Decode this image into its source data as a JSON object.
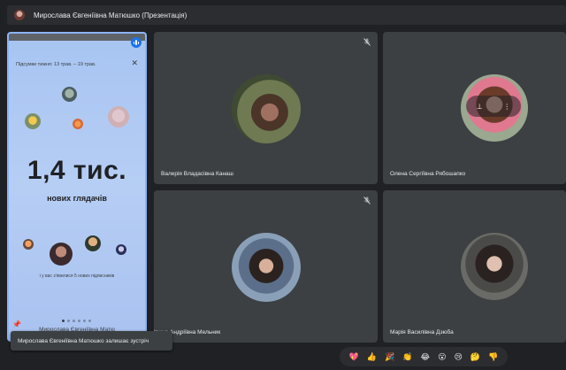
{
  "topbar": {
    "title": "Мирослава Євгеніївна Матюшко (Презентація)"
  },
  "presentation": {
    "week": "Підсумки тижня: 13 трав. – 19 трав.",
    "big_number": "1,4 тис.",
    "big_caption": "нових глядачів",
    "subscribers": "і у вас з'явилися 5 нових підписників",
    "presenter_name": "Мирослава Євгеніївна Матю",
    "slide_count": 6,
    "active_slide": 1
  },
  "tiles": [
    {
      "name": "Валерія Владасівна Канаш",
      "muted": true
    },
    {
      "name": "Олена Сергіївна Рябошапко",
      "muted": false
    },
    {
      "name": "Ірина Андріївна Мельник",
      "muted": true
    },
    {
      "name": "Марія Василівна Дзюба",
      "muted": false
    }
  ],
  "tile_controls": {
    "pin": "⊥",
    "more": "⋮"
  },
  "toast": {
    "text": "Мирослава Євгеніївна Матюшко залишає зустріч"
  },
  "reactions": [
    "💖",
    "👍",
    "🎉",
    "👏",
    "😂",
    "😮",
    "😢",
    "🤔",
    "👎"
  ]
}
